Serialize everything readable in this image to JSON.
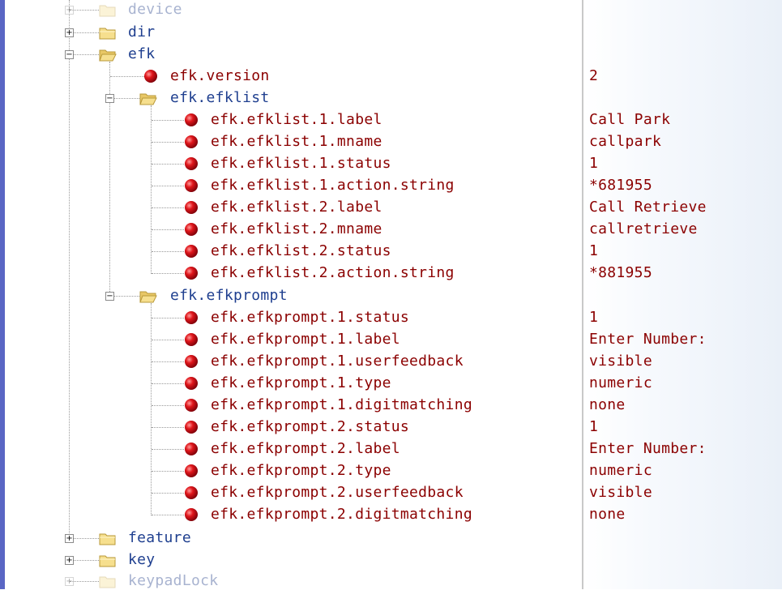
{
  "tree": {
    "top_level": [
      {
        "label": "device",
        "expander": "+",
        "state": "collapsed"
      },
      {
        "label": "dir",
        "expander": "+",
        "state": "collapsed"
      },
      {
        "label": "efk",
        "expander": "−",
        "state": "expanded"
      },
      {
        "label": "feature",
        "expander": "+",
        "state": "collapsed"
      },
      {
        "label": "key",
        "expander": "+",
        "state": "collapsed"
      },
      {
        "label": "keypadLock",
        "expander": "+",
        "state": "collapsed"
      }
    ],
    "efk": {
      "version": {
        "label": "efk.version",
        "value": "2"
      },
      "efklist": {
        "label": "efk.efklist",
        "expander": "−",
        "items": [
          {
            "label": "efk.efklist.1.label",
            "value": "Call Park"
          },
          {
            "label": "efk.efklist.1.mname",
            "value": "callpark"
          },
          {
            "label": "efk.efklist.1.status",
            "value": "1"
          },
          {
            "label": "efk.efklist.1.action.string",
            "value": "*681955"
          },
          {
            "label": "efk.efklist.2.label",
            "value": "Call Retrieve"
          },
          {
            "label": "efk.efklist.2.mname",
            "value": "callretrieve"
          },
          {
            "label": "efk.efklist.2.status",
            "value": "1"
          },
          {
            "label": "efk.efklist.2.action.string",
            "value": "*881955"
          }
        ]
      },
      "efkprompt": {
        "label": "efk.efkprompt",
        "expander": "−",
        "items": [
          {
            "label": "efk.efkprompt.1.status",
            "value": "1"
          },
          {
            "label": "efk.efkprompt.1.label",
            "value": "Enter Number:"
          },
          {
            "label": "efk.efkprompt.1.userfeedback",
            "value": "visible"
          },
          {
            "label": "efk.efkprompt.1.type",
            "value": "numeric"
          },
          {
            "label": "efk.efkprompt.1.digitmatching",
            "value": "none"
          },
          {
            "label": "efk.efkprompt.2.status",
            "value": "1"
          },
          {
            "label": "efk.efkprompt.2.label",
            "value": "Enter Number:"
          },
          {
            "label": "efk.efkprompt.2.type",
            "value": "numeric"
          },
          {
            "label": "efk.efkprompt.2.userfeedback",
            "value": "visible"
          },
          {
            "label": "efk.efkprompt.2.digitmatching",
            "value": "none"
          }
        ]
      }
    }
  },
  "icons": {
    "folder": "folder-icon",
    "leaf": "red-ball-icon",
    "expander": "tree-expander-icon"
  },
  "colors": {
    "key_text": "#8b0000",
    "folder_text": "#1f3f8f",
    "folder_fill": "#f6df8e",
    "leaf_ball": "#e0161b",
    "accent_bar": "#5a66c4"
  }
}
